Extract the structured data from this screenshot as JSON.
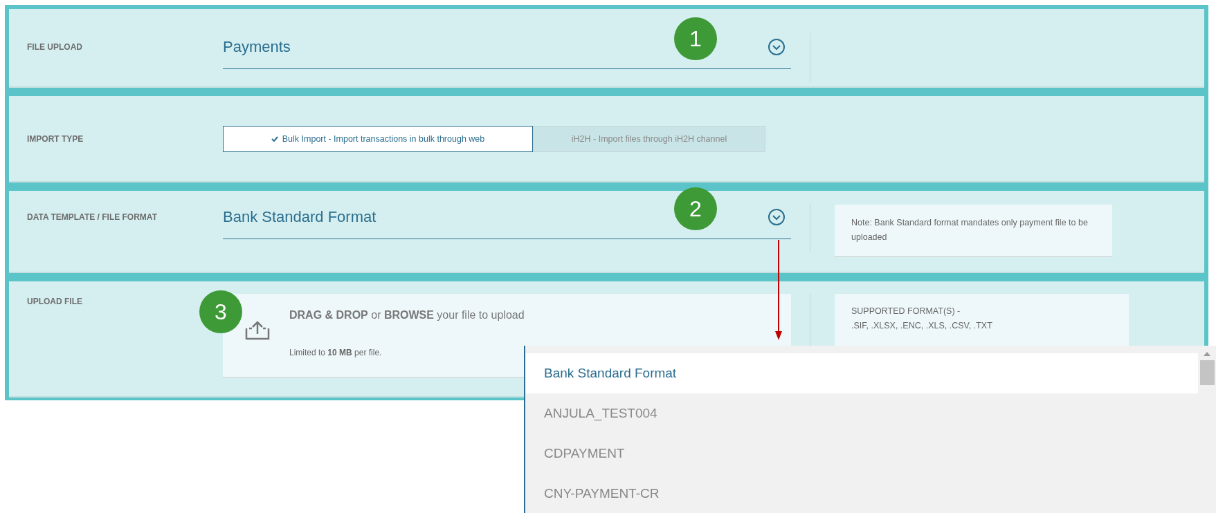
{
  "sections": [
    {
      "kind": "select",
      "label": "FILE UPLOAD",
      "value": "Payments",
      "marker": "1"
    },
    {
      "kind": "toggle",
      "label": "IMPORT TYPE",
      "options": [
        {
          "label": "Bulk Import - Import transactions in bulk through web",
          "selected": true
        },
        {
          "label": "iH2H - Import files through iH2H channel",
          "selected": false
        }
      ]
    },
    {
      "kind": "select",
      "label": "DATA TEMPLATE / FILE FORMAT",
      "value": "Bank Standard Format",
      "marker": "2",
      "note": "Note: Bank Standard format mandates only payment file to be uploaded"
    },
    {
      "kind": "upload",
      "label": "UPLOAD FILE",
      "marker": "3",
      "prompt": "**DRAG & DROP** or **BROWSE** your file to upload",
      "limit": "Limited to **10 MB** per file.",
      "note": "SUPPORTED FORMAT(S) -\n.SIF, .XLSX, .ENC, .XLS, .CSV, .TXT"
    }
  ],
  "dropdown": {
    "items": [
      {
        "label": "Bank Standard Format",
        "selected": true
      },
      {
        "label": "ANJULA_TEST004",
        "selected": false
      },
      {
        "label": "CDPAYMENT",
        "selected": false
      },
      {
        "label": "CNY-PAYMENT-CR",
        "selected": false
      }
    ]
  }
}
